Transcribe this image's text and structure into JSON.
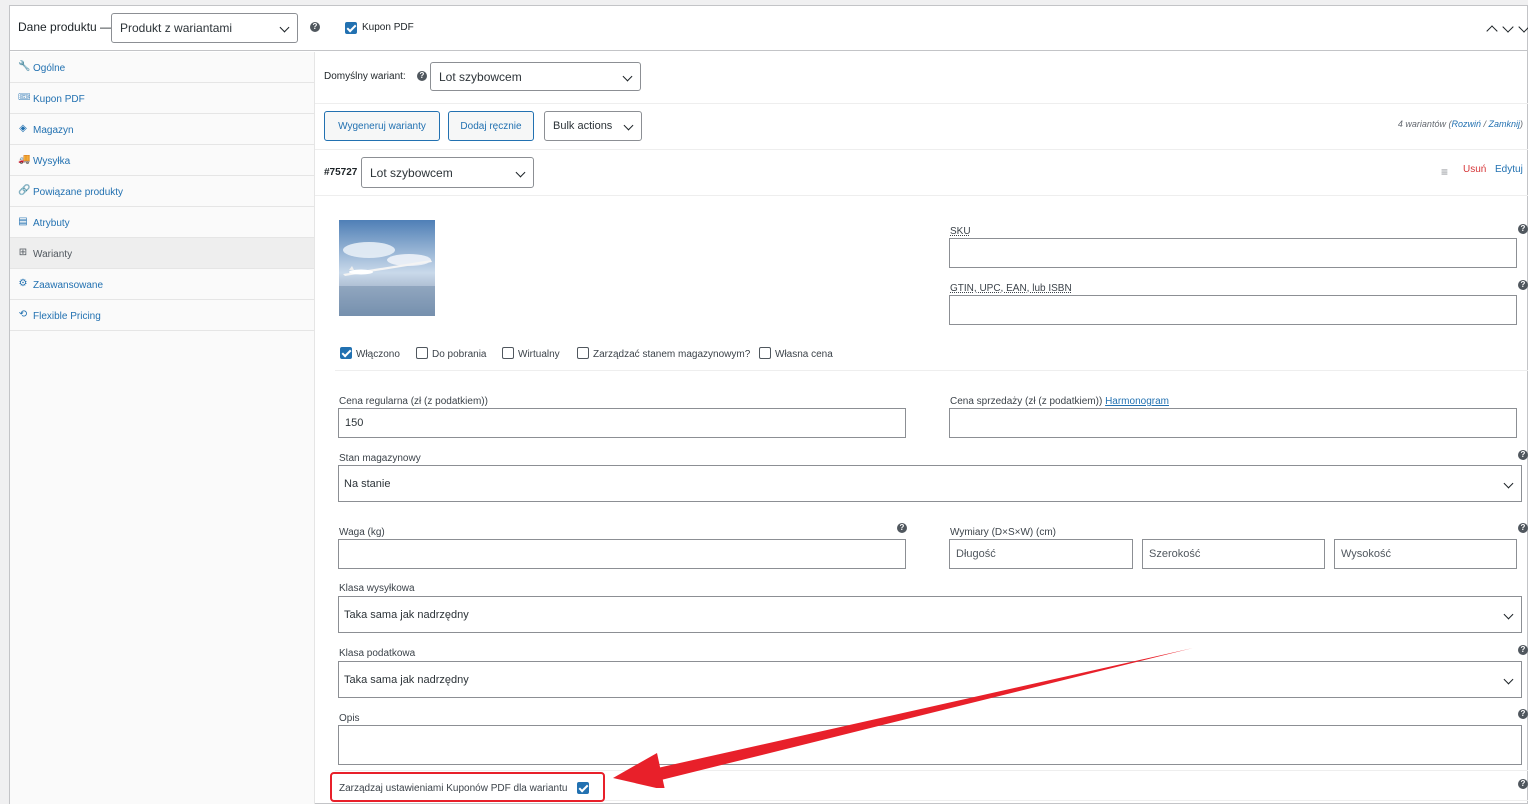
{
  "header": {
    "title": "Dane produktu —",
    "product_type": "Produkt z wariantami",
    "help": "?",
    "pdf_coupon_label": "Kupon PDF",
    "pdf_coupon_checked": true
  },
  "sidebar": {
    "items": [
      {
        "label": "Ogólne",
        "icon": "wrench-icon",
        "glyph": "🔧"
      },
      {
        "label": "Kupon PDF",
        "icon": "ticket-icon",
        "glyph": "🎟"
      },
      {
        "label": "Magazyn",
        "icon": "tag-icon",
        "glyph": "◈"
      },
      {
        "label": "Wysyłka",
        "icon": "truck-icon",
        "glyph": "🚚"
      },
      {
        "label": "Powiązane produkty",
        "icon": "link-icon",
        "glyph": "🔗"
      },
      {
        "label": "Atrybuty",
        "icon": "list-icon",
        "glyph": "▤"
      },
      {
        "label": "Warianty",
        "icon": "grid-icon",
        "glyph": "⊞"
      },
      {
        "label": "Zaawansowane",
        "icon": "gear-icon",
        "glyph": "⚙"
      },
      {
        "label": "Flexible Pricing",
        "icon": "refresh-icon",
        "glyph": "⟲"
      }
    ],
    "active_index": 6
  },
  "defaults": {
    "label": "Domyślny wariant:",
    "value": "Lot szybowcem"
  },
  "toolbar": {
    "generate_label": "Wygeneruj warianty",
    "add_manual_label": "Dodaj ręcznie",
    "bulk_actions_label": "Bulk actions",
    "count_prefix": "4 wariantów (",
    "expand_label": "Rozwiń",
    "separator": " / ",
    "collapse_label": "Zamknij",
    "count_suffix": ")"
  },
  "variation": {
    "id": "#75727",
    "name": "Lot szybowcem",
    "menu_glyph": "≡",
    "remove_label": "Usuń",
    "edit_label": "Edytuj",
    "sku_label": "SKU",
    "sku_value": "",
    "gtin_label": "GTIN, UPC, EAN, lub ISBN",
    "gtin_value": "",
    "options": [
      {
        "label": "Włączono",
        "checked": true
      },
      {
        "label": "Do pobrania",
        "checked": false
      },
      {
        "label": "Wirtualny",
        "checked": false
      },
      {
        "label": "Zarządzać stanem magazynowym?",
        "checked": false
      },
      {
        "label": "Własna cena",
        "checked": false
      }
    ],
    "regular_price_label": "Cena regularna (zł (z podatkiem))",
    "regular_price_value": "150",
    "sale_price_label": "Cena sprzedaży (zł (z podatkiem))",
    "schedule_label": "Harmonogram",
    "sale_price_value": "",
    "stock_status_label": "Stan magazynowy",
    "stock_status_value": "Na stanie",
    "weight_label": "Waga (kg)",
    "weight_value": "",
    "dimensions_label": "Wymiary (D×S×W) (cm)",
    "length_placeholder": "Długość",
    "width_placeholder": "Szerokość",
    "height_placeholder": "Wysokość",
    "shipping_class_label": "Klasa wysyłkowa",
    "shipping_class_value": "Taka sama jak nadrzędny",
    "tax_class_label": "Klasa podatkowa",
    "tax_class_value": "Taka sama jak nadrzędny",
    "description_label": "Opis",
    "description_value": "",
    "pdf_settings_label": "Zarządzaj ustawieniami Kuponów PDF dla wariantu",
    "pdf_settings_checked": true
  },
  "colors": {
    "accent": "#2271b1",
    "danger": "#d63638",
    "annotation": "#e8202a"
  }
}
